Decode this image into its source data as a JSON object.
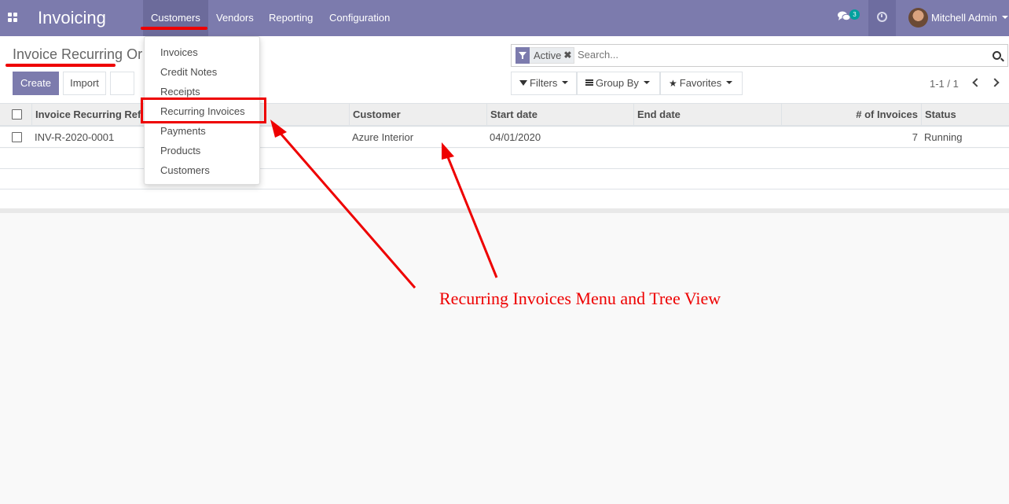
{
  "navbar": {
    "app_title": "Invoicing",
    "menu": [
      "Customers",
      "Vendors",
      "Reporting",
      "Configuration"
    ],
    "chat_badge": "3",
    "user_name": "Mitchell Admin",
    "color": "#7c7bad"
  },
  "control_panel": {
    "title": "Invoice Recurring Or",
    "create_label": "Create",
    "import_label": "Import",
    "search": {
      "facet_label": "Active",
      "placeholder": "Search..."
    },
    "filters_label": "Filters",
    "group_by_label": "Group By",
    "favorites_label": "Favorites",
    "pager": "1-1 / 1"
  },
  "table": {
    "columns": [
      "Invoice Recurring Ref",
      "Customer",
      "Start date",
      "End date",
      "# of Invoices",
      "Status"
    ],
    "rows": [
      {
        "ref": "INV-R-2020-0001",
        "customer": "Azure Interior",
        "start_date": "04/01/2020",
        "end_date": "",
        "num_invoices": "7",
        "status": "Running"
      }
    ]
  },
  "customers_dropdown": {
    "items": [
      "Invoices",
      "Credit Notes",
      "Receipts",
      "Recurring Invoices",
      "Payments",
      "Products",
      "Customers"
    ]
  },
  "annotation": {
    "text": "Recurring Invoices Menu and Tree View",
    "color": "#e00000"
  }
}
